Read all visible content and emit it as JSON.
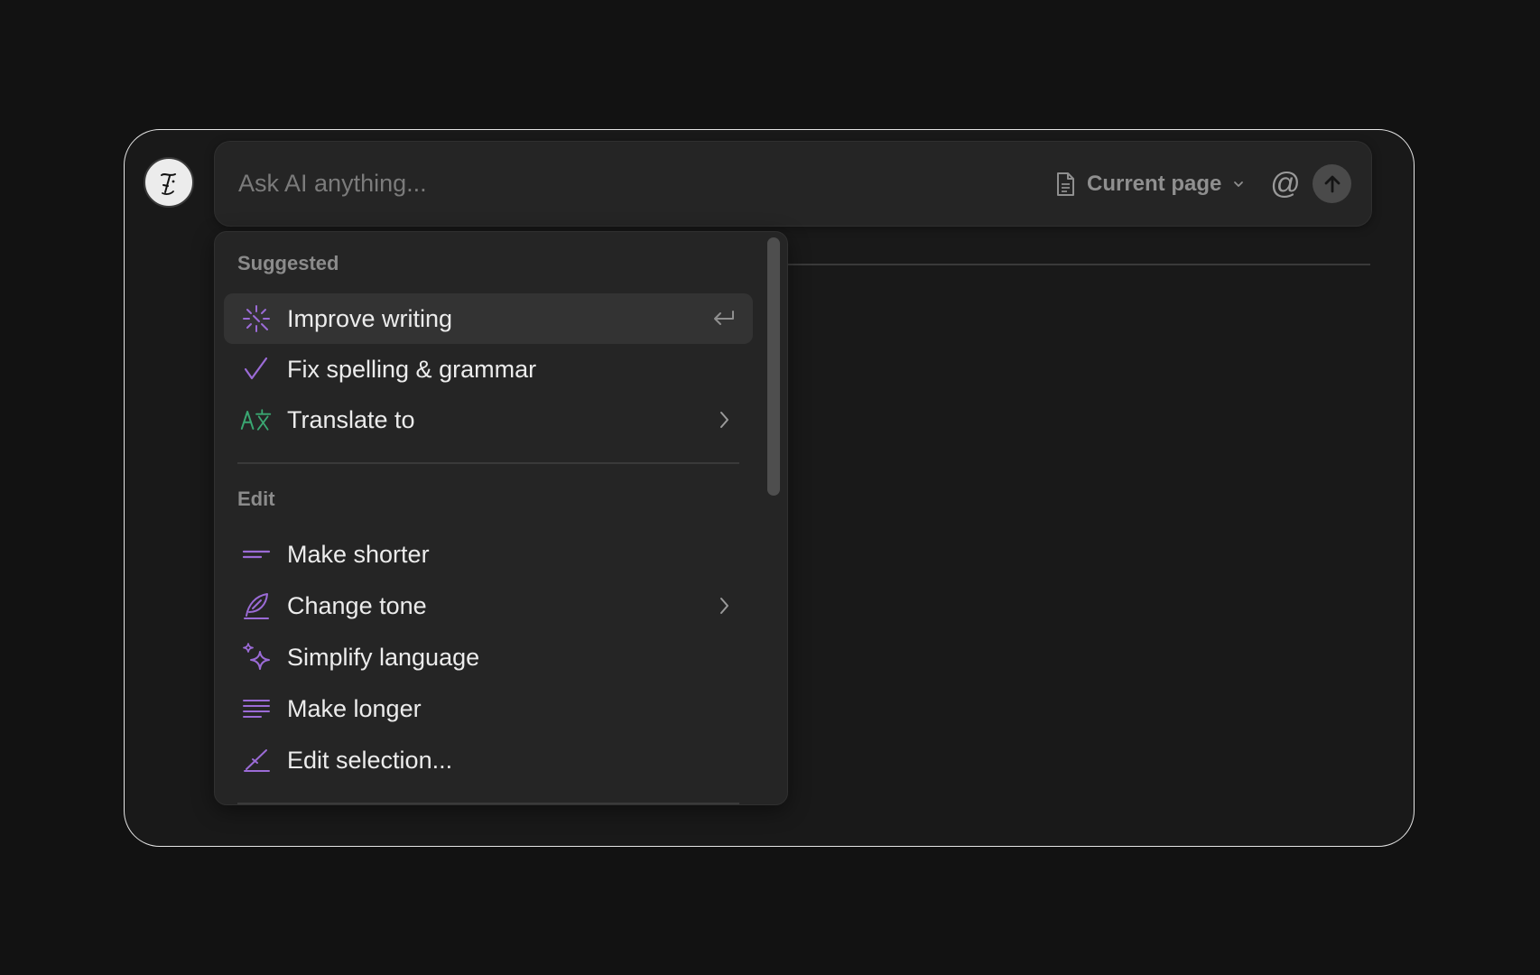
{
  "prompt": {
    "placeholder": "Ask AI anything...",
    "scope_label": "Current page",
    "scope_icon": "document-icon",
    "mention_symbol": "@",
    "send_icon": "arrow-up-icon"
  },
  "avatar": {
    "icon": "notion-ai-face-icon"
  },
  "menu": {
    "sections": [
      {
        "label": "Suggested",
        "items": [
          {
            "label": "Improve writing",
            "icon": "sparkle-burst-icon",
            "trail": "enter-key-icon",
            "active": true
          },
          {
            "label": "Fix spelling & grammar",
            "icon": "check-icon"
          },
          {
            "label": "Translate to",
            "icon": "translate-icon",
            "trail": "chevron-right-icon"
          }
        ]
      },
      {
        "label": "Edit",
        "items": [
          {
            "label": "Make shorter",
            "icon": "short-lines-icon"
          },
          {
            "label": "Change tone",
            "icon": "feather-pen-icon",
            "trail": "chevron-right-icon"
          },
          {
            "label": "Simplify language",
            "icon": "sparkles-icon"
          },
          {
            "label": "Make longer",
            "icon": "long-lines-icon"
          },
          {
            "label": "Edit selection...",
            "icon": "pencil-angle-icon"
          }
        ]
      }
    ]
  },
  "colors": {
    "background": "#121212",
    "panel": "#191919",
    "surface": "#252525",
    "accent_purple": "#9b6bd6",
    "accent_green": "#3aa772",
    "text_primary": "#ececec",
    "text_muted": "#8b8b8b"
  }
}
